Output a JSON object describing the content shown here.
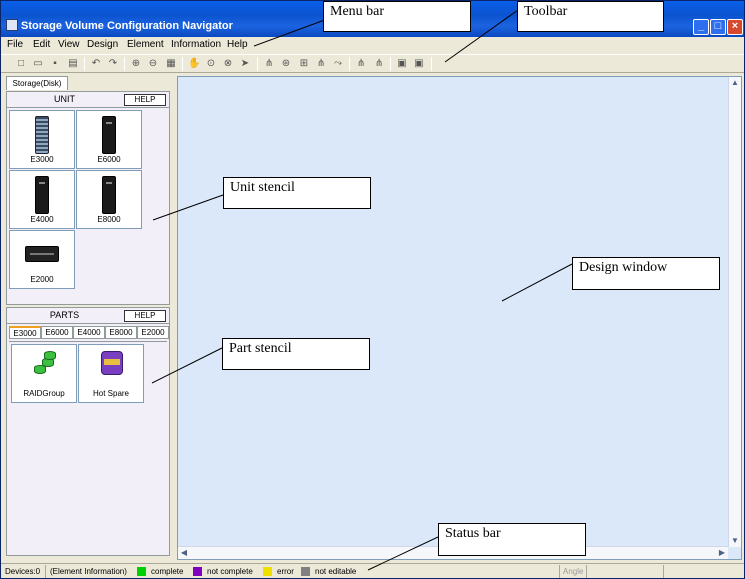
{
  "window": {
    "title": "Storage Volume Configuration Navigator",
    "min_symbol": "_",
    "max_symbol": "□",
    "close_symbol": "×"
  },
  "menu": [
    "File",
    "Edit",
    "View",
    "Design",
    "Element",
    "Information",
    "Help"
  ],
  "toolbar_icons": [
    "new-file-icon",
    "open-folder-icon",
    "save-icon",
    "print-icon",
    "undo-icon",
    "redo-icon",
    "zoom-in-icon",
    "zoom-out-icon",
    "fit-icon",
    "hand-icon",
    "zoom-area-icon",
    "zoom-select-icon",
    "pointer-icon",
    "layout-tree-icon",
    "layout-circle-icon",
    "layout-box-icon",
    "layout-hierarchy-icon",
    "layout-flow-icon",
    "expand-icon",
    "collapse-icon",
    "import-icon",
    "export-icon"
  ],
  "left_pane": {
    "tab": "Storage(Disk)",
    "unit": {
      "title": "UNIT",
      "help": "HELP",
      "items": [
        "E3000",
        "E6000",
        "E4000",
        "E8000",
        "E2000"
      ]
    },
    "parts": {
      "title": "PARTS",
      "help": "HELP",
      "tabs": [
        "E3000",
        "E6000",
        "E4000",
        "E8000",
        "E2000"
      ],
      "items": [
        "RAIDGroup",
        "Hot Spare"
      ]
    }
  },
  "status": {
    "devices": "Devices:0",
    "element_info": "(Element Information)",
    "legend": [
      {
        "label": "complete",
        "color": "#00d000"
      },
      {
        "label": "not complete",
        "color": "#8000c0"
      },
      {
        "label": "error",
        "color": "#f0e000"
      },
      {
        "label": "not editable",
        "color": "#808080"
      }
    ],
    "angle": "Angle"
  },
  "callouts": {
    "menu_bar": "Menu bar",
    "toolbar": "Toolbar",
    "unit_stencil": "Unit stencil",
    "design_window": "Design window",
    "part_stencil": "Part stencil",
    "status_bar": "Status bar"
  }
}
